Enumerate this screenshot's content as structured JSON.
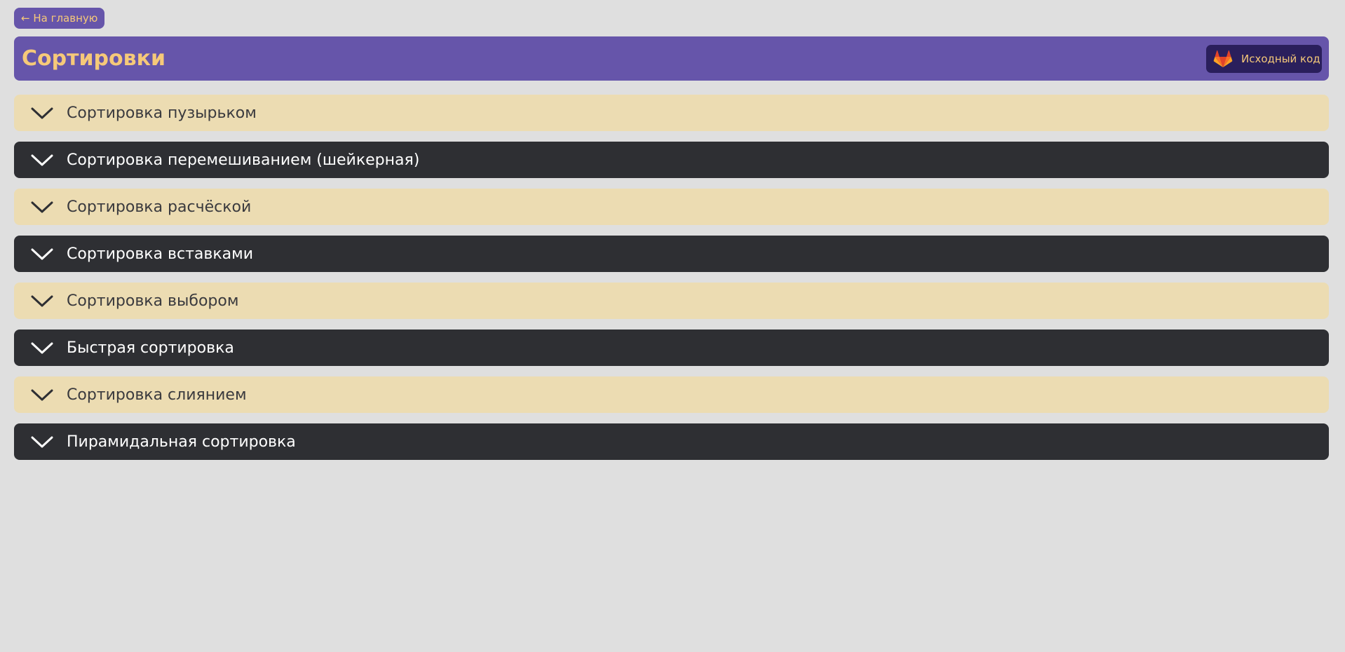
{
  "nav": {
    "back_label": "← На главную"
  },
  "header": {
    "title": "Сортировки",
    "source_label": "Исходный код",
    "source_icon": "gitlab-icon"
  },
  "colors": {
    "background": "#dfdfdf",
    "accent_purple": "#6655aa",
    "accent_text": "#f6c979",
    "item_light": "#ecdcb2",
    "item_dark": "#2e2f33",
    "button_dark": "#2a1f5c"
  },
  "accordion": {
    "items": [
      {
        "label": "Сортировка пузырьком",
        "theme": "light",
        "icon": "chevron-down-icon"
      },
      {
        "label": "Сортировка перемешиванием (шейкерная)",
        "theme": "dark",
        "icon": "chevron-down-icon"
      },
      {
        "label": "Сортировка расчёской",
        "theme": "light",
        "icon": "chevron-down-icon"
      },
      {
        "label": "Сортировка вставками",
        "theme": "dark",
        "icon": "chevron-down-icon"
      },
      {
        "label": "Сортировка выбором",
        "theme": "light",
        "icon": "chevron-down-icon"
      },
      {
        "label": "Быстрая сортировка",
        "theme": "dark",
        "icon": "chevron-down-icon"
      },
      {
        "label": "Сортировка слиянием",
        "theme": "light",
        "icon": "chevron-down-icon"
      },
      {
        "label": "Пирамидальная сортировка",
        "theme": "dark",
        "icon": "chevron-down-icon"
      }
    ]
  }
}
